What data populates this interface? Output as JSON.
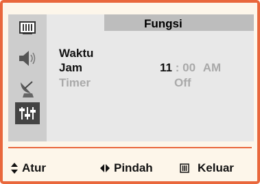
{
  "menu": {
    "title": "Fungsi",
    "section_label": "Waktu",
    "clock": {
      "label": "Jam",
      "hour": "11",
      "separator": ":",
      "minute": "00",
      "ampm": "AM"
    },
    "timer": {
      "label": "Timer",
      "value": "Off"
    }
  },
  "sidebar": {
    "items": [
      {
        "icon": "picture-icon"
      },
      {
        "icon": "speaker-icon"
      },
      {
        "icon": "satellite-dish-icon"
      },
      {
        "icon": "sliders-icon",
        "active": true
      }
    ]
  },
  "footer": {
    "adjust_label": "Atur",
    "move_label": "Pindah",
    "exit_label": "Keluar"
  }
}
